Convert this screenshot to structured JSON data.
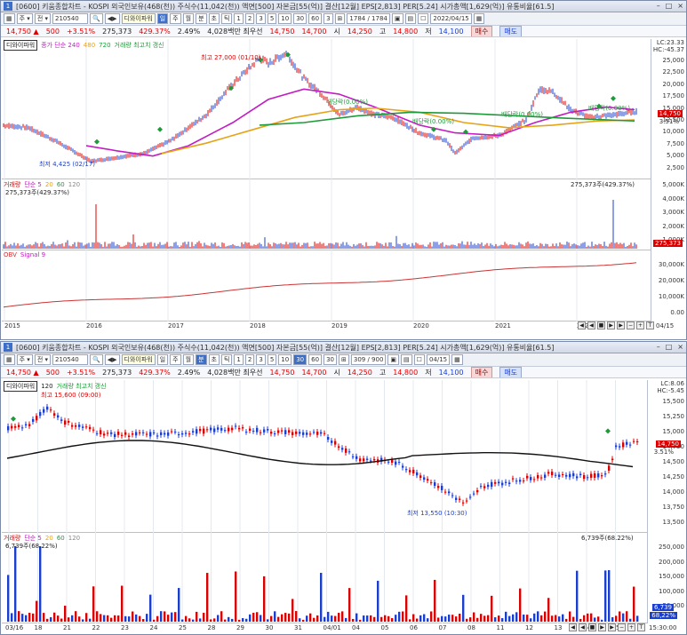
{
  "top": {
    "title_num": "1",
    "title": "[0600] 키움종합차트 - KOSPI 외국인보유(468(천)) 주식수(11,042(천)) 액면[500] 자본금[55(억)] 결산[12월] EPS[2,813] PER[5.24] 시가총액[1,629(억)] 유통비율[61.5]",
    "toolbar": {
      "code": "210540",
      "name": "디와이파워",
      "periods": [
        "일",
        "주",
        "월",
        "분",
        "초",
        "틱"
      ],
      "minutes": [
        "1",
        "2",
        "3",
        "5",
        "10",
        "30",
        "60"
      ],
      "period_count": "3",
      "count": "1784",
      "total": "1784",
      "date": "2022/04/15"
    },
    "quote": {
      "price": "14,750 ▲",
      "change": "500",
      "rate": "+3.51%",
      "volume": "275,373",
      "vol_ratio": "429.37%",
      "turnover": "2.49%",
      "amount": "4,028백만 최우선",
      "ask": "14,750",
      "bid": "14,700",
      "open_label": "시",
      "open": "14,250",
      "high_label": "고",
      "high": "14,800",
      "low_label": "저",
      "low": "14,100",
      "buy": "매수",
      "sell": "매도"
    },
    "price_legend": [
      "디와이파워",
      "종가 단순 240",
      "480",
      "720",
      "거래량 최고치 갱신"
    ],
    "price_ticks": [
      "25,000",
      "22,500",
      "20,000",
      "17,500",
      "15,000",
      "12,500",
      "10,000",
      "7,500",
      "5,000",
      "2,500"
    ],
    "lc": "LC:23.33",
    "hc": "HC:-45.37",
    "last_price": "14,750",
    "last_pct": "3.51%",
    "annotations": {
      "high": "최고 27,000 (01/10)",
      "low": "최저 4,425 (02/17)",
      "div1": "배당락(0.00%)",
      "div2": "배당락(0.00%)",
      "div3": "배당락(0.00%)",
      "div4": "배당락(0.00%)",
      "div5": "배당락(0.00%)"
    },
    "volume_legend": [
      "거래량",
      "단순 5",
      "20",
      "60",
      "120"
    ],
    "volume_value": "275,373주(429.37%)",
    "volume_right": "275,373주(429.37%)",
    "volume_ticks": [
      "5,000K",
      "4,000K",
      "3,000K",
      "2,000K",
      "1,000K"
    ],
    "volume_last": "275,373",
    "obv_legend": [
      "OBV",
      "Signal 9"
    ],
    "obv_ticks": [
      "30,000K",
      "20,000K",
      "10,000K",
      "0.00"
    ],
    "years": [
      "2015",
      "2016",
      "2017",
      "2018",
      "2019",
      "2020",
      "2021",
      "2022"
    ],
    "date_end": "04/15"
  },
  "bottom": {
    "title_num": "1",
    "title": "[0600] 키움종합차트 - KOSPI 외국인보유(468(천)) 주식수(11,042(천)) 액면[500] 자본금[55(억)] 결산[12월] EPS[2,813] PER[5.24] 시가총액[1,629(억)] 유통비율[61.5]",
    "toolbar": {
      "code": "210540",
      "name": "디와이파워",
      "periods": [
        "일",
        "주",
        "월",
        "분",
        "초",
        "틱"
      ],
      "minutes": [
        "1",
        "2",
        "3",
        "5",
        "10",
        "30",
        "60"
      ],
      "period_count": "30",
      "count": "309",
      "total": "900",
      "date": "04/15"
    },
    "quote": {
      "price": "14,750 ▲",
      "change": "500",
      "rate": "+3.51%",
      "volume": "275,373",
      "vol_ratio": "429.37%",
      "turnover": "2.49%",
      "amount": "4,028백만 최우선",
      "ask": "14,750",
      "bid": "14,700",
      "open_label": "시",
      "open": "14,250",
      "high_label": "고",
      "high": "14,800",
      "low_label": "저",
      "low": "14,100",
      "buy": "매수",
      "sell": "매도"
    },
    "price_legend": [
      "디와이파워",
      "120",
      "거래량 최고치 갱신"
    ],
    "price_ticks": [
      "15,500",
      "15,250",
      "15,000",
      "14,750",
      "14,500",
      "14,250",
      "14,000",
      "13,750",
      "13,500"
    ],
    "lc": "LC:8.06",
    "hc": "HC:-5.45",
    "last_price": "14,750",
    "last_pct": "3.51%",
    "annotations": {
      "high": "최고 15,600 (09:00)",
      "low": "최저 13,550 (10:30)"
    },
    "volume_legend": [
      "거래량",
      "단순 5",
      "20",
      "60",
      "120"
    ],
    "volume_value": "6,739주(68.22%)",
    "volume_right": "6,739주(68.22%)",
    "volume_ticks": [
      "250,000",
      "200,000",
      "150,000",
      "100,000",
      "50,000"
    ],
    "volume_last": "6,739",
    "volume_last2": "68,22%",
    "dates": [
      "03/16",
      "18",
      "21",
      "22",
      "23",
      "24",
      "25",
      "28",
      "29",
      "30",
      "31",
      "04/01",
      "04",
      "05",
      "06",
      "07",
      "08",
      "11",
      "12",
      "13",
      "14",
      "15"
    ],
    "time_end": "15:30:00"
  },
  "colors": {
    "up": "#d00000",
    "down": "#1a3fcf",
    "ma240": "#c21cc2",
    "ma480": "#e6a317",
    "ma720": "#1f9a3a",
    "obv": "#c33",
    "ma120": "#111111"
  }
}
